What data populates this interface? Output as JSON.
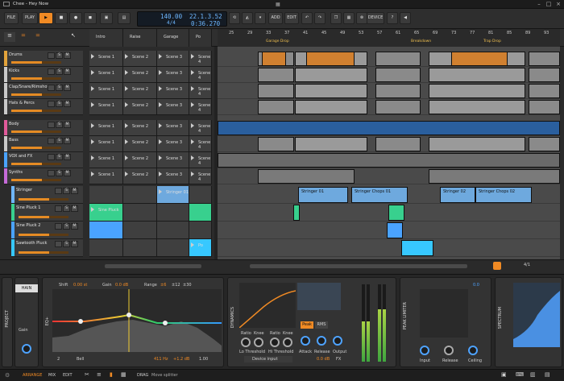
{
  "window": {
    "title": "Chee - Hey Now"
  },
  "toolbar": {
    "file": "FILE",
    "play": "PLAY",
    "add": "ADD",
    "edit": "EDIT",
    "device": "DEVICE",
    "tempo": "140.00",
    "signature": "4/4",
    "position": "22.1.3.52",
    "time": "0:36.270"
  },
  "scenes": [
    "Intro",
    "Raise",
    "Garage",
    "Po"
  ],
  "ruler": {
    "bars": [
      "25",
      "29",
      "33",
      "37",
      "41",
      "45",
      "49",
      "53",
      "57",
      "61",
      "65",
      "69",
      "73",
      "77",
      "81",
      "85",
      "89",
      "93"
    ],
    "markers": [
      "Garage Drop",
      "Breakdown",
      "Trap Drop"
    ]
  },
  "tracks": [
    {
      "name": "Drums",
      "color": "#e2a33b",
      "scenes": [
        "Scene 1",
        "Scene 2",
        "Scene 3",
        "Scene 4"
      ]
    },
    {
      "name": "Kicks",
      "color": "#c9c9c9",
      "scenes": [
        "Scene 1",
        "Scene 2",
        "Scene 3",
        "Scene 4"
      ]
    },
    {
      "name": "Clap/Snare/Rimshot",
      "color": "#c9c9c9",
      "scenes": [
        "Scene 1",
        "Scene 2",
        "Scene 3",
        "Scene 4"
      ]
    },
    {
      "name": "Hats & Percs",
      "color": "#c9c9c9",
      "scenes": [
        "Scene 1",
        "Scene 2",
        "Scene 3",
        "Scene 4"
      ]
    },
    {
      "name": "Body",
      "color": "#e05a9a",
      "scenes": [
        "Scene 1",
        "Scene 2",
        "Scene 3",
        "Scene 4"
      ]
    },
    {
      "name": "Bass",
      "color": "#c9c9c9",
      "scenes": [
        "Scene 1",
        "Scene 2",
        "Scene 3",
        "Scene 4"
      ]
    },
    {
      "name": "VOX and FX",
      "color": "#4aa3ff",
      "scenes": [
        "Scene 1",
        "Scene 2",
        "Scene 3",
        "Scene 4"
      ]
    },
    {
      "name": "Synths",
      "color": "#c56bd8",
      "scenes": [
        "Scene 1",
        "Scene 2",
        "Scene 3",
        "Scene 4"
      ]
    },
    {
      "name": "Stringer",
      "color": "#6fb6ff",
      "scenes": [
        "",
        "",
        "Stringer 01",
        ""
      ]
    },
    {
      "name": "Sine Pluck 1",
      "color": "#38d08e",
      "scenes": [
        "Sine Pluck",
        "",
        "",
        ""
      ]
    },
    {
      "name": "Sine Pluck 2",
      "color": "#4aa3ff",
      "scenes": [
        "",
        "",
        "",
        ""
      ]
    },
    {
      "name": "Sawtooth Pluck",
      "color": "#37c8ff",
      "scenes": [
        "",
        "",
        "",
        "Po"
      ]
    }
  ],
  "clips": {
    "stringer": [
      "Stringer 01",
      "Stringer Chops 01",
      "Stringer 02",
      "Stringer Chops 02"
    ]
  },
  "devices": {
    "eq": {
      "label": "EQ+",
      "shift": "Shift",
      "shift_val": "0.00 st",
      "gain": "Gain",
      "gain_val": "0.0 dB",
      "range": "Range",
      "ranges": [
        "±6",
        "±12",
        "±30"
      ],
      "band": "Bell",
      "freq": "411 Hz",
      "db": "+1.2 dB",
      "q": "1.00",
      "band_num": "2"
    },
    "dynamics": {
      "label": "DYNAMICS",
      "knobs": [
        "Ratio",
        "Knee",
        "Ratio",
        "Knee"
      ],
      "lo": "Lo Threshold",
      "hi": "Hi Threshold",
      "peak": "Peak",
      "rms": "RMS",
      "attack": "Attack",
      "release": "Release",
      "output": "Output",
      "input_sel": "Device input",
      "out_val": "0.0 dB",
      "fx": "FX"
    },
    "limiter": {
      "label": "PEAK LIMITER",
      "input": "Input",
      "release": "Release",
      "ceiling": "Ceiling",
      "val": "0.0"
    },
    "spectrum": {
      "label": "SPECTRUM"
    },
    "project": "PROJECT",
    "chain": "HAIN",
    "gain": "Gain"
  },
  "status": {
    "tabs": [
      "ARRANGE",
      "MIX",
      "EDIT"
    ],
    "drag": "DRAG",
    "hint": "Move splitter",
    "page": "4/1"
  }
}
